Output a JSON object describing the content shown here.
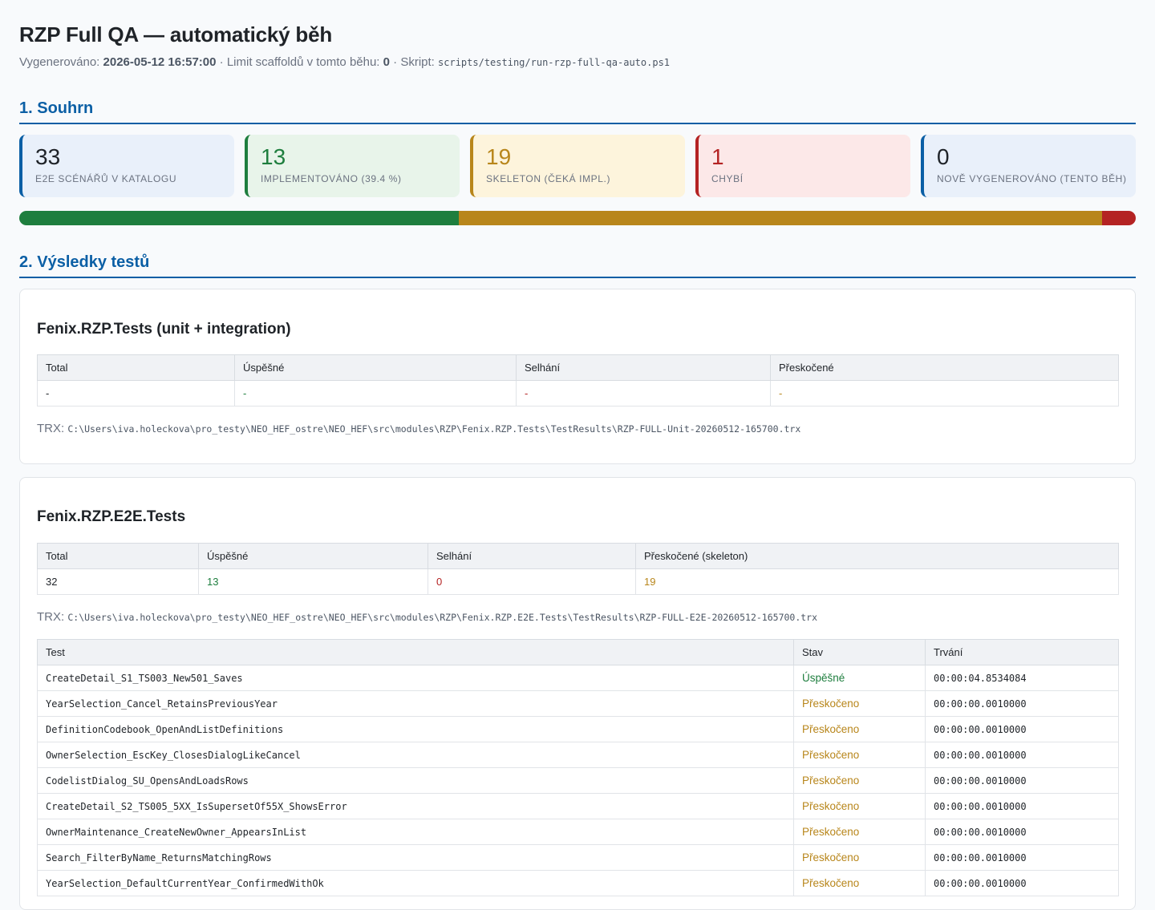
{
  "header": {
    "title": "RZP Full QA — automatický běh",
    "generated_label": "Vygenerováno:",
    "generated_value": "2026-05-12 16:57:00",
    "limit_label": "· Limit scaffoldů v tomto běhu:",
    "limit_value": "0",
    "script_label": "· Skript:",
    "script_value": "scripts/testing/run-rzp-full-qa-auto.ps1"
  },
  "summary": {
    "heading": "1. Souhrn",
    "cards": [
      {
        "value": "33",
        "label": "E2E scénářů v katalogu"
      },
      {
        "value": "13",
        "label": "Implementováno (39.4 %)"
      },
      {
        "value": "19",
        "label": "Skeleton (čeká impl.)"
      },
      {
        "value": "1",
        "label": "Chybí"
      },
      {
        "value": "0",
        "label": "Nově vygenerováno (tento běh)"
      }
    ],
    "progress": [
      {
        "name": "implemented",
        "value": 13,
        "color": "#1e7e3e"
      },
      {
        "name": "skeleton",
        "value": 19,
        "color": "#b8861b"
      },
      {
        "name": "missing",
        "value": 1,
        "color": "#b42323"
      }
    ]
  },
  "results": {
    "heading": "2. Výsledky testů",
    "unit": {
      "title": "Fenix.RZP.Tests (unit + integration)",
      "headers": [
        "Total",
        "Úspěšné",
        "Selhání",
        "Přeskočené"
      ],
      "values": [
        "-",
        "-",
        "-",
        "-"
      ],
      "trx_label": "TRX:",
      "trx_path": "C:\\Users\\iva.holeckova\\pro_testy\\NEO_HEF_ostre\\NEO_HEF\\src\\modules\\RZP\\Fenix.RZP.Tests\\TestResults\\RZP-FULL-Unit-20260512-165700.trx"
    },
    "e2e": {
      "title": "Fenix.RZP.E2E.Tests",
      "headers": [
        "Total",
        "Úspěšné",
        "Selhání",
        "Přeskočené (skeleton)"
      ],
      "values": [
        "32",
        "13",
        "0",
        "19"
      ],
      "trx_label": "TRX:",
      "trx_path": "C:\\Users\\iva.holeckova\\pro_testy\\NEO_HEF_ostre\\NEO_HEF\\src\\modules\\RZP\\Fenix.RZP.E2E.Tests\\TestResults\\RZP-FULL-E2E-20260512-165700.trx",
      "test_headers": [
        "Test",
        "Stav",
        "Trvání"
      ],
      "tests": [
        {
          "name": "CreateDetail_S1_TS003_New501_Saves",
          "status": "Úspěšné",
          "kind": "ok",
          "duration": "00:00:04.8534084"
        },
        {
          "name": "YearSelection_Cancel_RetainsPreviousYear",
          "status": "Přeskočeno",
          "kind": "skip",
          "duration": "00:00:00.0010000"
        },
        {
          "name": "DefinitionCodebook_OpenAndListDefinitions",
          "status": "Přeskočeno",
          "kind": "skip",
          "duration": "00:00:00.0010000"
        },
        {
          "name": "OwnerSelection_EscKey_ClosesDialogLikeCancel",
          "status": "Přeskočeno",
          "kind": "skip",
          "duration": "00:00:00.0010000"
        },
        {
          "name": "CodelistDialog_SU_OpensAndLoadsRows",
          "status": "Přeskočeno",
          "kind": "skip",
          "duration": "00:00:00.0010000"
        },
        {
          "name": "CreateDetail_S2_TS005_5XX_IsSupersetOf55X_ShowsError",
          "status": "Přeskočeno",
          "kind": "skip",
          "duration": "00:00:00.0010000"
        },
        {
          "name": "OwnerMaintenance_CreateNewOwner_AppearsInList",
          "status": "Přeskočeno",
          "kind": "skip",
          "duration": "00:00:00.0010000"
        },
        {
          "name": "Search_FilterByName_ReturnsMatchingRows",
          "status": "Přeskočeno",
          "kind": "skip",
          "duration": "00:00:00.0010000"
        },
        {
          "name": "YearSelection_DefaultCurrentYear_ConfirmedWithOk",
          "status": "Přeskočeno",
          "kind": "skip",
          "duration": "00:00:00.0010000"
        }
      ]
    }
  }
}
